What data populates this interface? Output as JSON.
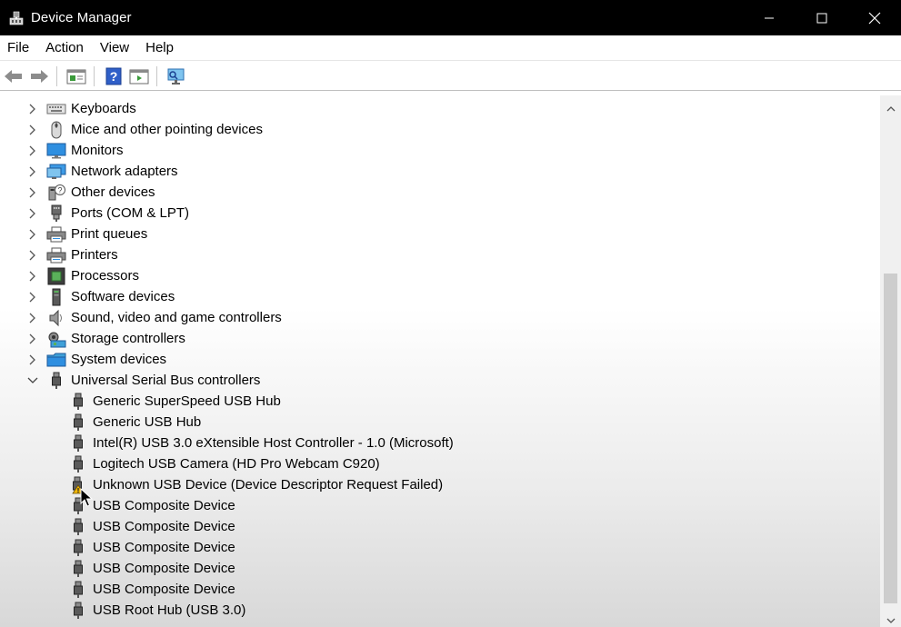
{
  "window": {
    "title": "Device Manager",
    "icon": "device-manager-icon"
  },
  "window_controls": {
    "minimize": "—",
    "maximize": "☐",
    "close": "✕"
  },
  "menu": [
    "File",
    "Action",
    "View",
    "Help"
  ],
  "toolbar": [
    "back-arrow-icon",
    "forward-arrow-icon",
    "properties-icon",
    "help-icon",
    "run-icon",
    "scan-hardware-icon"
  ],
  "tree": {
    "categories": [
      {
        "label": "Keyboards",
        "icon": "keyboard-icon"
      },
      {
        "label": "Mice and other pointing devices",
        "icon": "mouse-icon"
      },
      {
        "label": "Monitors",
        "icon": "monitor-icon"
      },
      {
        "label": "Network adapters",
        "icon": "network-adapter-icon"
      },
      {
        "label": "Other devices",
        "icon": "other-devices-icon"
      },
      {
        "label": "Ports (COM & LPT)",
        "icon": "port-icon"
      },
      {
        "label": "Print queues",
        "icon": "printer-icon"
      },
      {
        "label": "Printers",
        "icon": "printer-icon"
      },
      {
        "label": "Processors",
        "icon": "processor-icon"
      },
      {
        "label": "Software devices",
        "icon": "software-device-icon"
      },
      {
        "label": "Sound, video and game controllers",
        "icon": "speaker-icon"
      },
      {
        "label": "Storage controllers",
        "icon": "storage-controller-icon"
      },
      {
        "label": "System devices",
        "icon": "system-folder-icon"
      }
    ],
    "usb": {
      "label": "Universal Serial Bus controllers",
      "icon": "usb-plug-icon",
      "expanded": true,
      "children": [
        {
          "label": "Generic SuperSpeed USB Hub",
          "warning": false
        },
        {
          "label": "Generic USB Hub",
          "warning": false
        },
        {
          "label": "Intel(R) USB 3.0 eXtensible Host Controller - 1.0 (Microsoft)",
          "warning": false
        },
        {
          "label": "Logitech USB Camera (HD Pro Webcam C920)",
          "warning": false
        },
        {
          "label": "Unknown USB Device (Device Descriptor Request Failed)",
          "warning": true
        },
        {
          "label": "USB Composite Device",
          "warning": false
        },
        {
          "label": "USB Composite Device",
          "warning": false
        },
        {
          "label": "USB Composite Device",
          "warning": false
        },
        {
          "label": "USB Composite Device",
          "warning": false
        },
        {
          "label": "USB Composite Device",
          "warning": false
        },
        {
          "label": "USB Root Hub (USB 3.0)",
          "warning": false
        }
      ]
    }
  },
  "colors": {
    "titlebar": "#000000",
    "warning": "#f2b705",
    "monitor": "#2f8fe0",
    "accent": "#1e6fd0"
  }
}
